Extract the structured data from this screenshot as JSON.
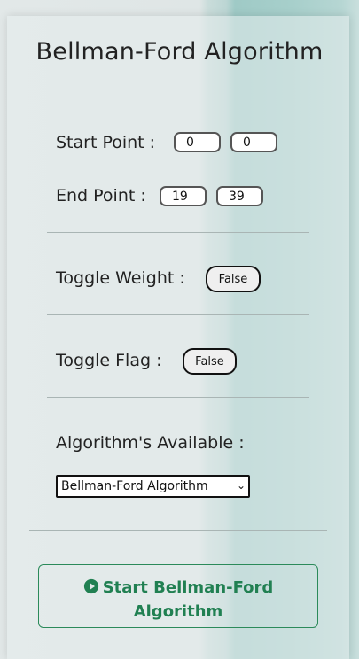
{
  "title": "Bellman-Ford Algorithm",
  "start_point": {
    "label": "Start Point :",
    "x": "0",
    "y": "0"
  },
  "end_point": {
    "label": "End Point :",
    "x": "19",
    "y": "39"
  },
  "toggle_weight": {
    "label": "Toggle Weight :",
    "value": "False"
  },
  "toggle_flag": {
    "label": "Toggle Flag :",
    "value": "False"
  },
  "algorithms": {
    "label": "Algorithm's Available :",
    "selected": "Bellman-Ford Algorithm"
  },
  "start_button": {
    "line1": "Start Bellman-Ford",
    "line2": "Algorithm",
    "icon": "play-circle-icon"
  },
  "colors": {
    "accent": "#218052",
    "teal_background": "#9fcac6"
  }
}
